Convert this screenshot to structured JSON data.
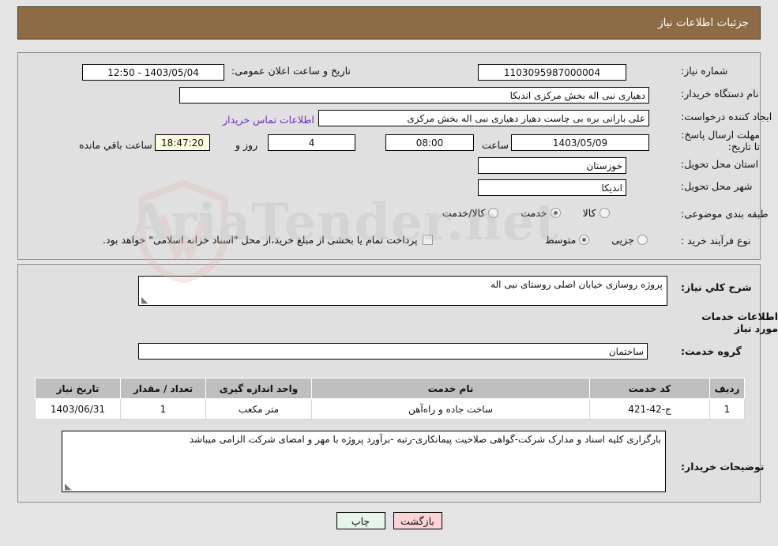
{
  "header": {
    "title": "جزئیات اطلاعات نیاز"
  },
  "watermark": {
    "text": "AriaTender.net"
  },
  "form": {
    "need_number": {
      "label": "شماره نیاز:",
      "value": "1103095987000004"
    },
    "announce_datetime": {
      "label": "تاریخ و ساعت اعلان عمومی:",
      "value": "1403/05/04 - 12:50"
    },
    "buyer_org": {
      "label": "نام دستگاه خریدار:",
      "value": "دهیاری نبی اله بخش مرکزی اندیکا"
    },
    "request_creator": {
      "label": "ایجاد کننده درخواست:",
      "value": "علی بارانی بره بی چاست دهیار دهیاری نبی اله بخش مرکزی"
    },
    "contact_link": "اطلاعات تماس خریدار",
    "deadline": {
      "label": "مهلت ارسال پاسخ: تا تاریخ:",
      "date": "1403/05/09",
      "hour_label": "ساعت",
      "hour": "08:00",
      "days": "4",
      "days_label": "روز و",
      "countdown": "18:47:20",
      "countdown_label": "ساعت باقي مانده"
    },
    "delivery_province": {
      "label": "استان محل تحویل:",
      "value": "خوزستان"
    },
    "delivery_city": {
      "label": "شهر محل تحویل:",
      "value": "اندیکا"
    },
    "subject_category": {
      "label": "طبقه بندی موضوعی:",
      "options": [
        "کالا",
        "خدمت",
        "کالا/خدمت"
      ],
      "selected": "خدمت"
    },
    "purchase_process": {
      "label": "نوع فرآیند خرید :",
      "options": [
        "جزیی",
        "متوسط"
      ],
      "selected": "متوسط"
    },
    "treasury_checkbox": {
      "label": "پرداخت تمام یا بخشی از مبلغ خرید،از محل \"اسناد خزانه اسلامی\" خواهد بود.",
      "checked": false
    }
  },
  "details": {
    "general_description": {
      "label": "شرح کلي نیاز:",
      "value": "پروژه روسازی خیابان اصلی روستای نبی اله"
    },
    "services_section_title": "اطلاعات خدمات مورد نیاز",
    "service_group": {
      "label": "گروه خدمت:",
      "value": "ساختمان"
    },
    "buyer_notes": {
      "label": "توضیحات خریدار:",
      "value": "بارگزاری کلیه اسناد و مدارک شرکت-گواهی صلاحیت پیمانکاری-رتبه -برآورد پروژه با مهر و امضای شرکت الزامی میباشد"
    }
  },
  "table": {
    "columns": [
      "ردیف",
      "کد خدمت",
      "نام خدمت",
      "واحد اندازه گیری",
      "تعداد / مقدار",
      "تاریخ نیاز"
    ],
    "rows": [
      {
        "row": "1",
        "service_code": "ج-42-421",
        "service_name": "ساخت جاده و راه‌آهن",
        "unit": "متر مکعب",
        "quantity": "1",
        "need_date": "1403/06/31"
      }
    ]
  },
  "buttons": {
    "back": "بازگشت",
    "print": "چاپ"
  },
  "colors": {
    "header_bar": "#8c6b45",
    "panel_bg": "#e0e0e0",
    "page_bg": "#e4e4e4",
    "link": "#7030c0",
    "table_header": "#bfbfbf",
    "btn_back": "#fbd5d5",
    "btn_print": "#e6f6e6",
    "countdown_bg": "#fdfde4",
    "blue_text": "#1818c8"
  }
}
